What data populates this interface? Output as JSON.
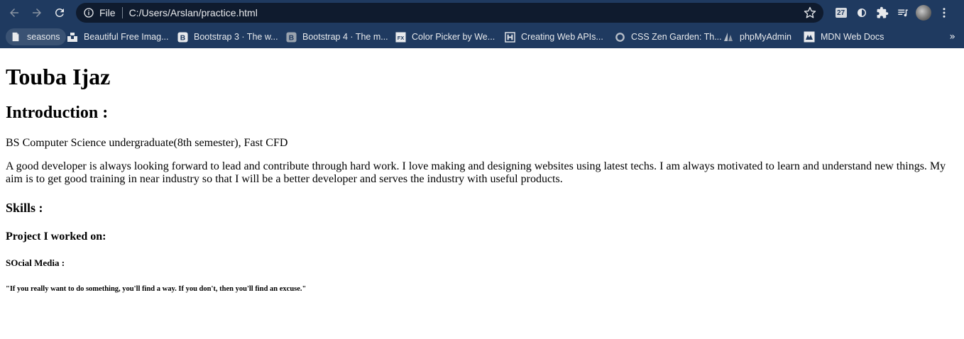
{
  "browser": {
    "omnibox": {
      "scheme": "File",
      "url": "C:/Users/Arslan/practice.html"
    },
    "extensions": {
      "badge_text": "27"
    },
    "bookmarks": [
      {
        "label": "seasons",
        "icon": "page-icon"
      },
      {
        "label": "Beautiful Free Imag...",
        "icon": "unsplash-icon"
      },
      {
        "label": "Bootstrap 3 · The w...",
        "icon": "bootstrap-icon"
      },
      {
        "label": "Bootstrap 4 · The m...",
        "icon": "bootstrap-icon"
      },
      {
        "label": "Color Picker by We...",
        "icon": "fx-icon"
      },
      {
        "label": "Creating Web APIs...",
        "icon": "api-icon"
      },
      {
        "label": "CSS Zen Garden: Th...",
        "icon": "circle-icon"
      },
      {
        "label": "phpMyAdmin",
        "icon": "sail-icon"
      },
      {
        "label": "MDN Web Docs",
        "icon": "mdn-icon"
      }
    ],
    "more_label": "»"
  },
  "page": {
    "name": "Touba Ijaz",
    "intro_heading": "Introduction :",
    "education": "BS Computer Science undergraduate(8th semester), Fast CFD",
    "about": "A good developer is always looking forward to lead and contribute through hard work. I love making and designing websites using latest techs. I am always motivated to learn and understand new things. My aim is to get good training in near industry so that I will be a better developer and serves the industry with useful products.",
    "skills_heading": "Skills :",
    "projects_heading": "Project I worked on:",
    "social_heading": "SOcial Media :",
    "quote": "\"If you really want to do something, you'll find a way. If you don't, then you'll find an excuse.\""
  },
  "colors": {
    "chrome_bg": "#1f3a60",
    "omnibox_bg": "#0f1b2e",
    "chrome_text": "#e8eaed"
  }
}
